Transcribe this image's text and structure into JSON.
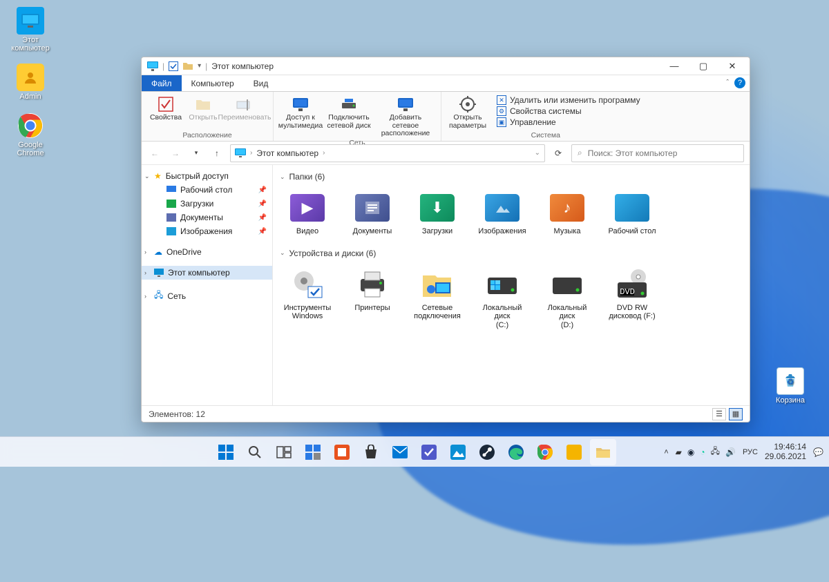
{
  "desktop": {
    "icons": [
      {
        "label": "Этот\nкомпьютер"
      },
      {
        "label": "Admin"
      },
      {
        "label": "Google\nChrome"
      }
    ],
    "recycle": "Корзина"
  },
  "window": {
    "title": "Этот компьютер",
    "tabs": [
      "Файл",
      "Компьютер",
      "Вид"
    ],
    "ribbon": {
      "group_location": "Расположение",
      "group_network": "Сеть",
      "group_system": "Система",
      "btn_properties": "Свойства",
      "btn_open": "Открыть",
      "btn_rename": "Переименовать",
      "btn_media": "Доступ к\nмультимедиа",
      "btn_mapdrive": "Подключить\nсетевой диск",
      "btn_addnet": "Добавить сетевое\nрасположение",
      "btn_opensettings": "Открыть\nпараметры",
      "link_uninstall": "Удалить или изменить программу",
      "link_sysprops": "Свойства системы",
      "link_manage": "Управление"
    },
    "address": {
      "location": "Этот компьютер",
      "search_placeholder": "Поиск: Этот компьютер"
    },
    "sidebar": {
      "quickaccess": "Быстрый доступ",
      "desktop": "Рабочий стол",
      "downloads": "Загрузки",
      "documents": "Документы",
      "pictures": "Изображения",
      "onedrive": "OneDrive",
      "thispc": "Этот компьютер",
      "network": "Сеть"
    },
    "content": {
      "folders_header": "Папки (6)",
      "folders": [
        "Видео",
        "Документы",
        "Загрузки",
        "Изображения",
        "Музыка",
        "Рабочий стол"
      ],
      "devices_header": "Устройства и диски (6)",
      "devices": [
        "Инструменты\nWindows",
        "Принтеры",
        "Сетевые\nподключения",
        "Локальный диск\n(C:)",
        "Локальный диск\n(D:)",
        "DVD RW\nдисковод (F:)"
      ]
    },
    "status": "Элементов: 12"
  },
  "taskbar": {
    "lang": "РУС",
    "time": "19:46:14",
    "date": "29.06.2021"
  }
}
